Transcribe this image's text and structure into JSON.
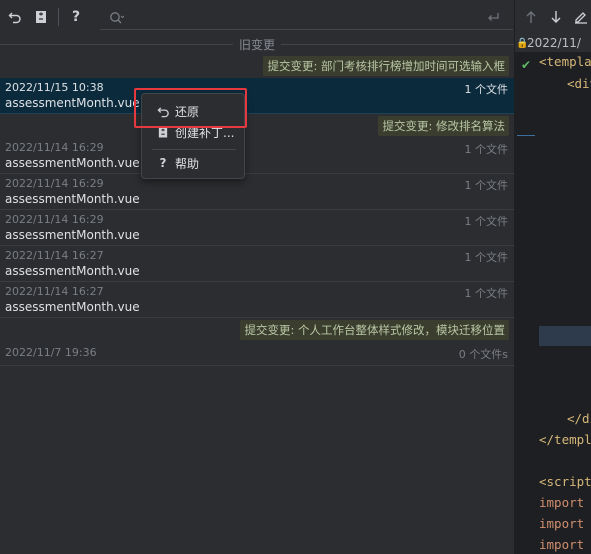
{
  "toolbar": {
    "search_placeholder": ""
  },
  "section": {
    "label": "旧变更"
  },
  "commits": [
    {
      "message": "提交变更: 部门考核排行榜增加时间可选输入框"
    },
    {
      "message": "提交变更: 修改排名算法"
    },
    {
      "message": "提交变更: 个人工作台整体样式修改，模块迁移位置"
    }
  ],
  "entries": [
    {
      "date": "2022/11/15 10:38",
      "file": "assessmentMonth.vue",
      "count": "1 个文件"
    },
    {
      "date": "2022/11/14 16:29",
      "file": "assessmentMonth.vue",
      "count": "1 个文件"
    },
    {
      "date": "2022/11/14 16:29",
      "file": "assessmentMonth.vue",
      "count": "1 个文件"
    },
    {
      "date": "2022/11/14 16:29",
      "file": "assessmentMonth.vue",
      "count": "1 个文件"
    },
    {
      "date": "2022/11/14 16:27",
      "file": "assessmentMonth.vue",
      "count": "1 个文件"
    },
    {
      "date": "2022/11/14 16:27",
      "file": "assessmentMonth.vue",
      "count": "1 个文件"
    },
    {
      "date": "2022/11/7 19:36",
      "file": "",
      "count": "0 个文件s"
    }
  ],
  "context_menu": {
    "revert": "还原",
    "create_patch": "创建补丁...",
    "help": "帮助"
  },
  "editor": {
    "path": "2022/11/",
    "lines": [
      "<templat",
      "<div",
      "</di",
      "</templa",
      "<script",
      "import c",
      "import",
      "import"
    ]
  },
  "colors": {
    "selection": "#0b2b3d",
    "highlight_box": "#e5383f",
    "badge_bg": "#3b3e2f"
  }
}
